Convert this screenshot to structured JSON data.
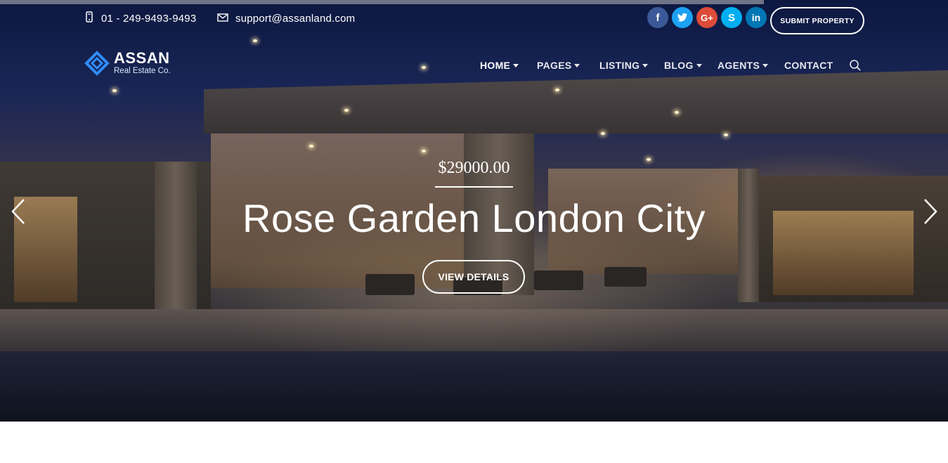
{
  "topbar": {
    "phone": "01 - 249-9493-9493",
    "email": "support@assanland.com",
    "submit_label": "SUBMIT PROPERTY",
    "social": [
      {
        "name": "facebook",
        "glyph": "f",
        "color": "#3b5998"
      },
      {
        "name": "twitter",
        "glyph": "t",
        "color": "#1da1f2"
      },
      {
        "name": "google-plus",
        "glyph": "G+",
        "color": "#dd4b39"
      },
      {
        "name": "skype",
        "glyph": "S",
        "color": "#00aff0"
      },
      {
        "name": "linkedin",
        "glyph": "in",
        "color": "#0077b5"
      }
    ]
  },
  "brand": {
    "name": "ASSAN",
    "tagline": "Real Estate Co.",
    "accent": "#2f8cff"
  },
  "nav": {
    "items": [
      {
        "label": "HOME",
        "dropdown": true,
        "active": true
      },
      {
        "label": "PAGES",
        "dropdown": true,
        "active": false
      },
      {
        "label": "LISTING",
        "dropdown": true,
        "active": false
      },
      {
        "label": "BLOG",
        "dropdown": true,
        "active": false
      },
      {
        "label": "AGENTS",
        "dropdown": true,
        "active": false
      },
      {
        "label": "CONTACT",
        "dropdown": false,
        "active": false
      }
    ],
    "search_icon": "search-icon"
  },
  "hero": {
    "price": "$29000.00",
    "title": "Rose Garden London City",
    "button_label": "VIEW DETAILS",
    "prev_icon": "chevron-left-icon",
    "next_icon": "chevron-right-icon"
  }
}
